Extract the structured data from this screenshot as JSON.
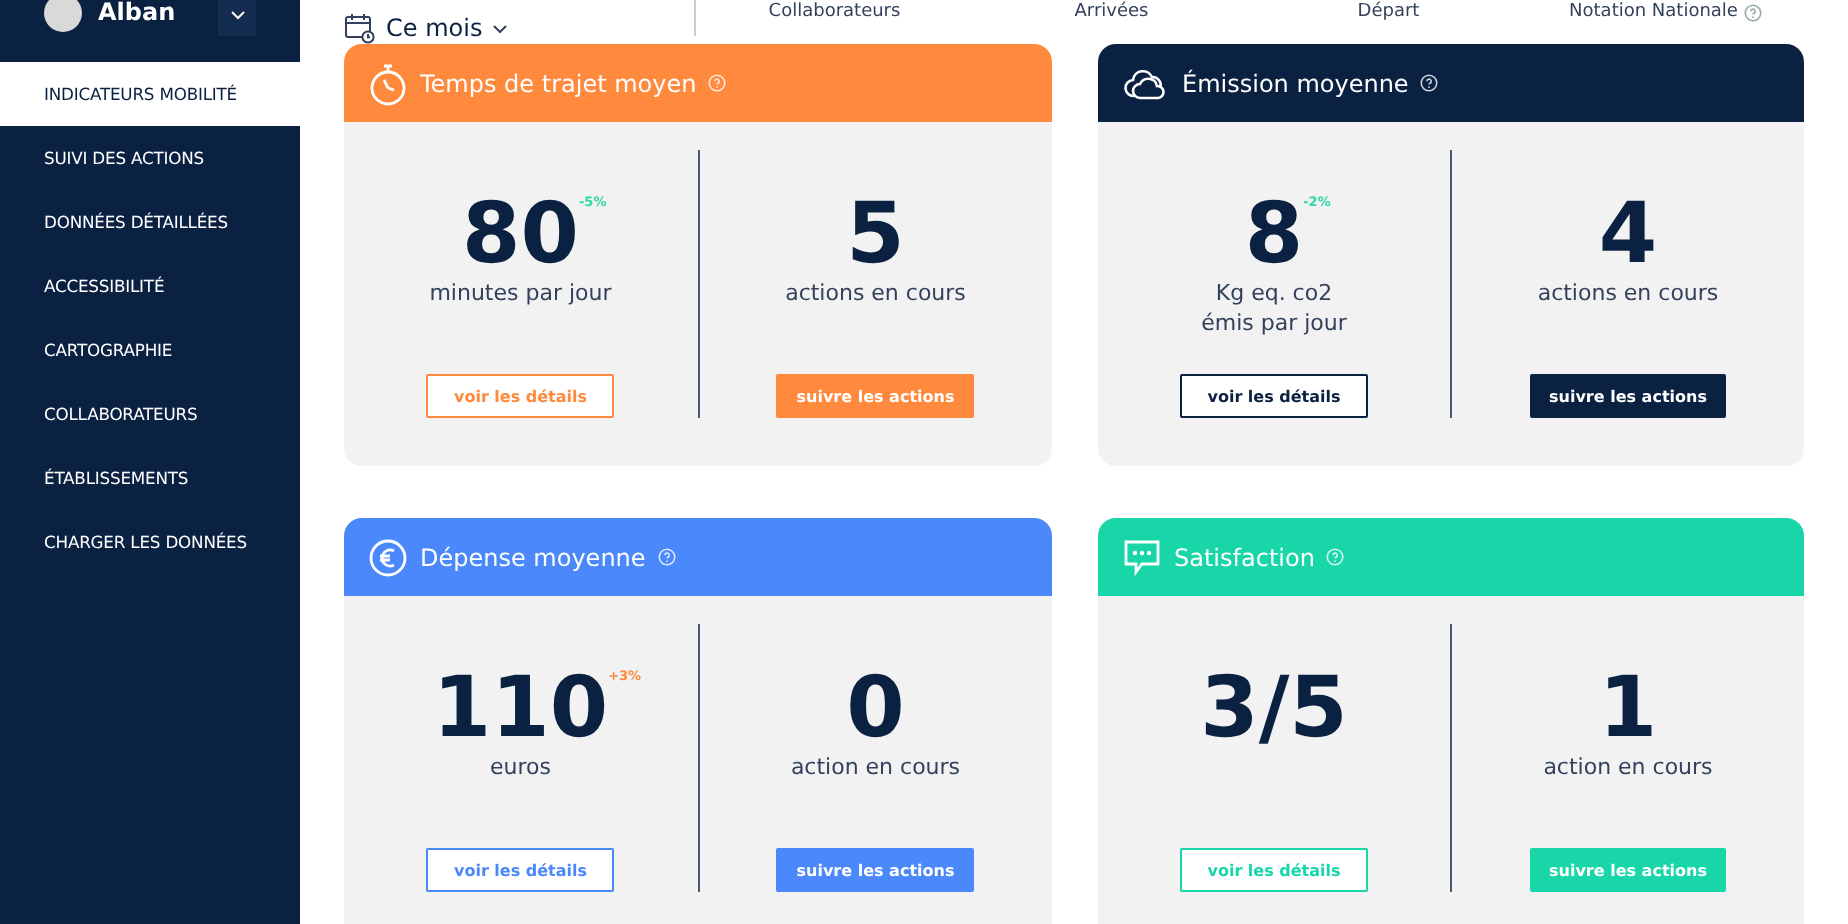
{
  "user": {
    "name": "Alban"
  },
  "sidebar": {
    "items": [
      {
        "label": "INDICATEURS MOBILITÉ",
        "selected": true
      },
      {
        "label": "SUIVI DES ACTIONS",
        "selected": false
      },
      {
        "label": "DONNÉES DÉTAILLÉES",
        "selected": false
      },
      {
        "label": "ACCESSIBILITÉ",
        "selected": false
      },
      {
        "label": "CARTOGRAPHIE",
        "selected": false
      },
      {
        "label": "COLLABORATEURS",
        "selected": false
      },
      {
        "label": "ÉTABLISSEMENTS",
        "selected": false
      },
      {
        "label": "CHARGER LES DONNÉES",
        "selected": false
      }
    ]
  },
  "period": {
    "label": "Ce mois"
  },
  "columns": [
    {
      "label": "Collaborateurs",
      "help": false
    },
    {
      "label": "Arrivées",
      "help": false
    },
    {
      "label": "Départ",
      "help": false
    },
    {
      "label": "Notation Nationale",
      "help": true
    }
  ],
  "cards": [
    {
      "kind": "stopwatch",
      "title": "Temps de trajet moyen",
      "color": "#ff8a3d",
      "value": "80",
      "delta": {
        "label": "-5%",
        "color": "#2ed8a7"
      },
      "unit": "minutes par jour",
      "details_button": "voir les détails",
      "actions_count": "5",
      "actions_label": "actions en cours",
      "actions_button": "suivre les actions"
    },
    {
      "kind": "cloud",
      "title": "Émission moyenne",
      "color": "#0b2141",
      "value": "8",
      "delta": {
        "label": "-2%",
        "color": "#2ed8a7"
      },
      "unit": "Kg eq. co2\némis par jour",
      "details_button": "voir les détails",
      "actions_count": "4",
      "actions_label": "actions en cours",
      "actions_button": "suivre les actions"
    },
    {
      "kind": "euro",
      "title": "Dépense moyenne",
      "color": "#4a88fb",
      "value": "110",
      "delta": {
        "label": "+3%",
        "color": "#ff8a3d"
      },
      "unit": "euros",
      "details_button": "voir les détails",
      "actions_count": "0",
      "actions_label": "action en cours",
      "actions_button": "suivre les actions"
    },
    {
      "kind": "chat",
      "title": "Satisfaction",
      "color": "#19d6a8",
      "value": "3/5",
      "details_button": "voir les détails",
      "actions_count": "1",
      "actions_label": "action en cours",
      "actions_button": "suivre les actions"
    }
  ]
}
